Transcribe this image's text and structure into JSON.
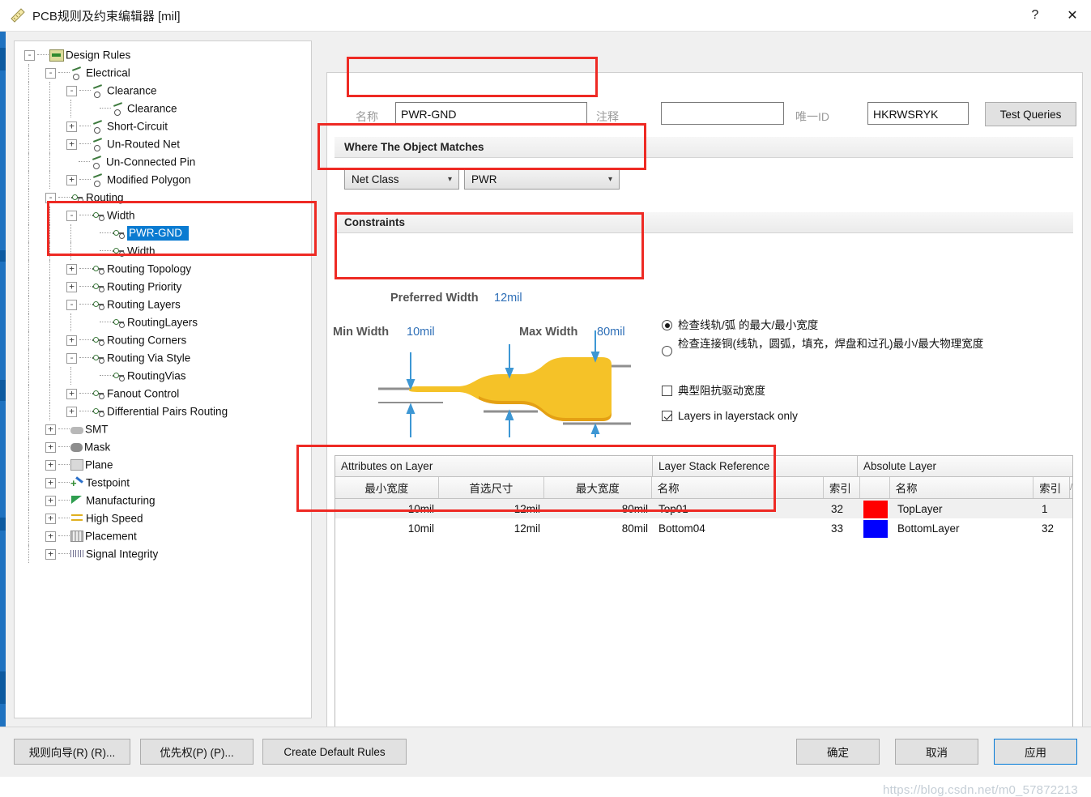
{
  "window": {
    "title": "PCB规则及约束编辑器 [mil]",
    "icon": "ruler-icon",
    "help_button": "?",
    "close_button": "✕"
  },
  "tree": {
    "items": [
      {
        "label": "Design Rules",
        "depth": 0,
        "expander": "-",
        "icon": "design-rules-icon",
        "selected": false
      },
      {
        "label": "Electrical",
        "depth": 1,
        "expander": "-",
        "icon": "electrical-icon",
        "selected": false
      },
      {
        "label": "Clearance",
        "depth": 2,
        "expander": "-",
        "icon": "electrical-icon",
        "selected": false
      },
      {
        "label": "Clearance",
        "depth": 3,
        "expander": "",
        "icon": "electrical-icon",
        "selected": false
      },
      {
        "label": "Short-Circuit",
        "depth": 2,
        "expander": "+",
        "icon": "electrical-icon",
        "selected": false
      },
      {
        "label": "Un-Routed Net",
        "depth": 2,
        "expander": "+",
        "icon": "electrical-icon",
        "selected": false
      },
      {
        "label": "Un-Connected Pin",
        "depth": 2,
        "expander": "",
        "icon": "electrical-icon",
        "selected": false
      },
      {
        "label": "Modified Polygon",
        "depth": 2,
        "expander": "+",
        "icon": "electrical-icon",
        "selected": false
      },
      {
        "label": "Routing",
        "depth": 1,
        "expander": "-",
        "icon": "routing-icon",
        "selected": false
      },
      {
        "label": "Width",
        "depth": 2,
        "expander": "-",
        "icon": "routing-icon",
        "selected": false
      },
      {
        "label": "PWR-GND",
        "depth": 3,
        "expander": "",
        "icon": "routing-icon",
        "selected": true
      },
      {
        "label": "Width",
        "depth": 3,
        "expander": "",
        "icon": "routing-icon",
        "selected": false
      },
      {
        "label": "Routing Topology",
        "depth": 2,
        "expander": "+",
        "icon": "routing-icon",
        "selected": false
      },
      {
        "label": "Routing Priority",
        "depth": 2,
        "expander": "+",
        "icon": "routing-icon",
        "selected": false
      },
      {
        "label": "Routing Layers",
        "depth": 2,
        "expander": "-",
        "icon": "routing-icon",
        "selected": false
      },
      {
        "label": "RoutingLayers",
        "depth": 3,
        "expander": "",
        "icon": "routing-icon",
        "selected": false
      },
      {
        "label": "Routing Corners",
        "depth": 2,
        "expander": "+",
        "icon": "routing-icon",
        "selected": false
      },
      {
        "label": "Routing Via Style",
        "depth": 2,
        "expander": "-",
        "icon": "routing-icon",
        "selected": false
      },
      {
        "label": "RoutingVias",
        "depth": 3,
        "expander": "",
        "icon": "routing-icon",
        "selected": false
      },
      {
        "label": "Fanout Control",
        "depth": 2,
        "expander": "+",
        "icon": "routing-icon",
        "selected": false
      },
      {
        "label": "Differential Pairs Routing",
        "depth": 2,
        "expander": "+",
        "icon": "routing-icon",
        "selected": false
      },
      {
        "label": "SMT",
        "depth": 1,
        "expander": "+",
        "icon": "smt-icon",
        "selected": false
      },
      {
        "label": "Mask",
        "depth": 1,
        "expander": "+",
        "icon": "mask-icon",
        "selected": false
      },
      {
        "label": "Plane",
        "depth": 1,
        "expander": "+",
        "icon": "plane-icon",
        "selected": false
      },
      {
        "label": "Testpoint",
        "depth": 1,
        "expander": "+",
        "icon": "testpoint-icon",
        "selected": false
      },
      {
        "label": "Manufacturing",
        "depth": 1,
        "expander": "+",
        "icon": "manufacturing-icon",
        "selected": false
      },
      {
        "label": "High Speed",
        "depth": 1,
        "expander": "+",
        "icon": "high-speed-icon",
        "selected": false
      },
      {
        "label": "Placement",
        "depth": 1,
        "expander": "+",
        "icon": "placement-icon",
        "selected": false
      },
      {
        "label": "Signal Integrity",
        "depth": 1,
        "expander": "+",
        "icon": "signal-integrity-icon",
        "selected": false
      }
    ]
  },
  "rule": {
    "name_label": "名称",
    "name_value": "PWR-GND",
    "comment_label": "注释",
    "comment_value": "",
    "unique_id_label": "唯一ID",
    "unique_id_value": "HKRWSRYK",
    "test_queries_label": "Test Queries"
  },
  "where_section": {
    "title": "Where The Object Matches",
    "scope_type": "Net Class",
    "scope_value": "PWR"
  },
  "constraints": {
    "title": "Constraints",
    "preferred_label": "Preferred Width",
    "preferred_value": "12mil",
    "min_label": "Min Width",
    "min_value": "10mil",
    "max_label": "Max Width",
    "max_value": "80mil",
    "options": {
      "radio1": "检查线轨/弧 的最大/最小宽度",
      "radio2": "检查连接铜(线轨，圆弧，填充，焊盘和过孔)最小/最大物理宽度",
      "check1": "典型阻抗驱动宽度",
      "check2": "Layers in layerstack only"
    }
  },
  "table": {
    "group_headers": [
      "Attributes on Layer",
      "Layer Stack Reference",
      "Absolute Layer"
    ],
    "columns": [
      "最小宽度",
      "首选尺寸",
      "最大宽度",
      "名称",
      "索引",
      "",
      "名称",
      "索引"
    ],
    "sort_marker": "/",
    "rows": [
      {
        "min_width": "10mil",
        "preferred": "12mil",
        "max_width": "80mil",
        "stack_name": "Top01",
        "stack_index": "32",
        "color": "#ff0000",
        "abs_name": "TopLayer",
        "abs_index": "1"
      },
      {
        "min_width": "10mil",
        "preferred": "12mil",
        "max_width": "80mil",
        "stack_name": "Bottom04",
        "stack_index": "33",
        "color": "#0000ff",
        "abs_name": "BottomLayer",
        "abs_index": "32"
      }
    ]
  },
  "footer": {
    "rule_wizard": "规则向导(R) (R)...",
    "priorities": "优先权(P) (P)...",
    "create_default": "Create Default Rules",
    "ok": "确定",
    "cancel": "取消",
    "apply": "应用"
  },
  "watermark": "https://blog.csdn.net/m0_57872213",
  "colors": {
    "accent": "#0078d7",
    "selection": "#0a7bd1",
    "annotation": "#ee2a24",
    "value_text": "#2e6fb7",
    "top_layer": "#ff0000",
    "bottom_layer": "#0000ff",
    "track": "#f5c228"
  }
}
